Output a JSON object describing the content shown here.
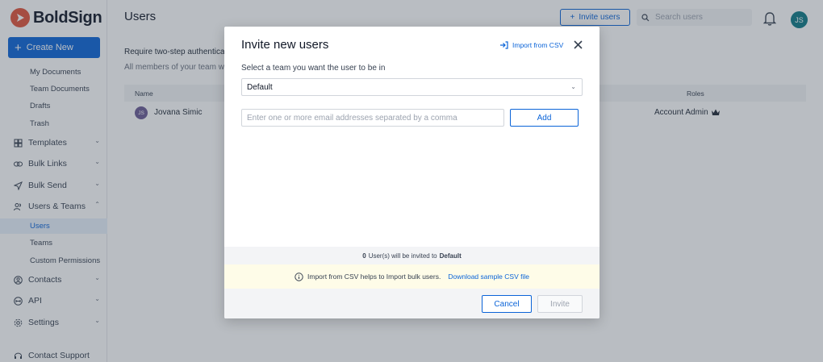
{
  "app": {
    "brand": "BoldSign"
  },
  "sidebar": {
    "create_label": "Create New",
    "doc_items": [
      {
        "label": "My Documents"
      },
      {
        "label": "Team Documents"
      },
      {
        "label": "Drafts"
      },
      {
        "label": "Trash"
      }
    ],
    "items": [
      {
        "label": "Templates",
        "icon": "grid-icon"
      },
      {
        "label": "Bulk Links",
        "icon": "link-icon"
      },
      {
        "label": "Bulk Send",
        "icon": "send-icon"
      },
      {
        "label": "Users & Teams",
        "icon": "users-icon"
      },
      {
        "label": "Contacts",
        "icon": "contacts-icon"
      },
      {
        "label": "API",
        "icon": "api-icon"
      },
      {
        "label": "Settings",
        "icon": "gear-icon"
      },
      {
        "label": "Contact Support",
        "icon": "headset-icon"
      }
    ],
    "users_sub": [
      {
        "label": "Users",
        "active": true
      },
      {
        "label": "Teams"
      },
      {
        "label": "Custom Permissions"
      }
    ]
  },
  "header": {
    "title": "Users",
    "invite_label": "Invite users",
    "search_placeholder": "Search users",
    "avatar_initials": "JS"
  },
  "main": {
    "twostep_title": "Require two-step authenticat",
    "twostep_desc": "All members of your team wi",
    "columns": {
      "name": "Name",
      "roles": "Roles"
    },
    "rows": [
      {
        "initials": "JS",
        "name": "Jovana Simic",
        "role": "Account Admin"
      }
    ]
  },
  "modal": {
    "title": "Invite new users",
    "import_label": "Import from CSV",
    "team_label": "Select a team you want the user to be in",
    "team_value": "Default",
    "email_placeholder": "Enter one or more email addresses separated by a comma",
    "add_label": "Add",
    "status_count": "0",
    "status_text": "User(s) will be invited to",
    "status_team": "Default",
    "info_text": "Import from CSV helps to Import bulk users.",
    "info_link": "Download sample CSV file",
    "cancel_label": "Cancel",
    "invite_label": "Invite"
  },
  "colors": {
    "accent": "#0b64d8",
    "brand": "#e0533b",
    "avatar": "#0f7a86"
  }
}
